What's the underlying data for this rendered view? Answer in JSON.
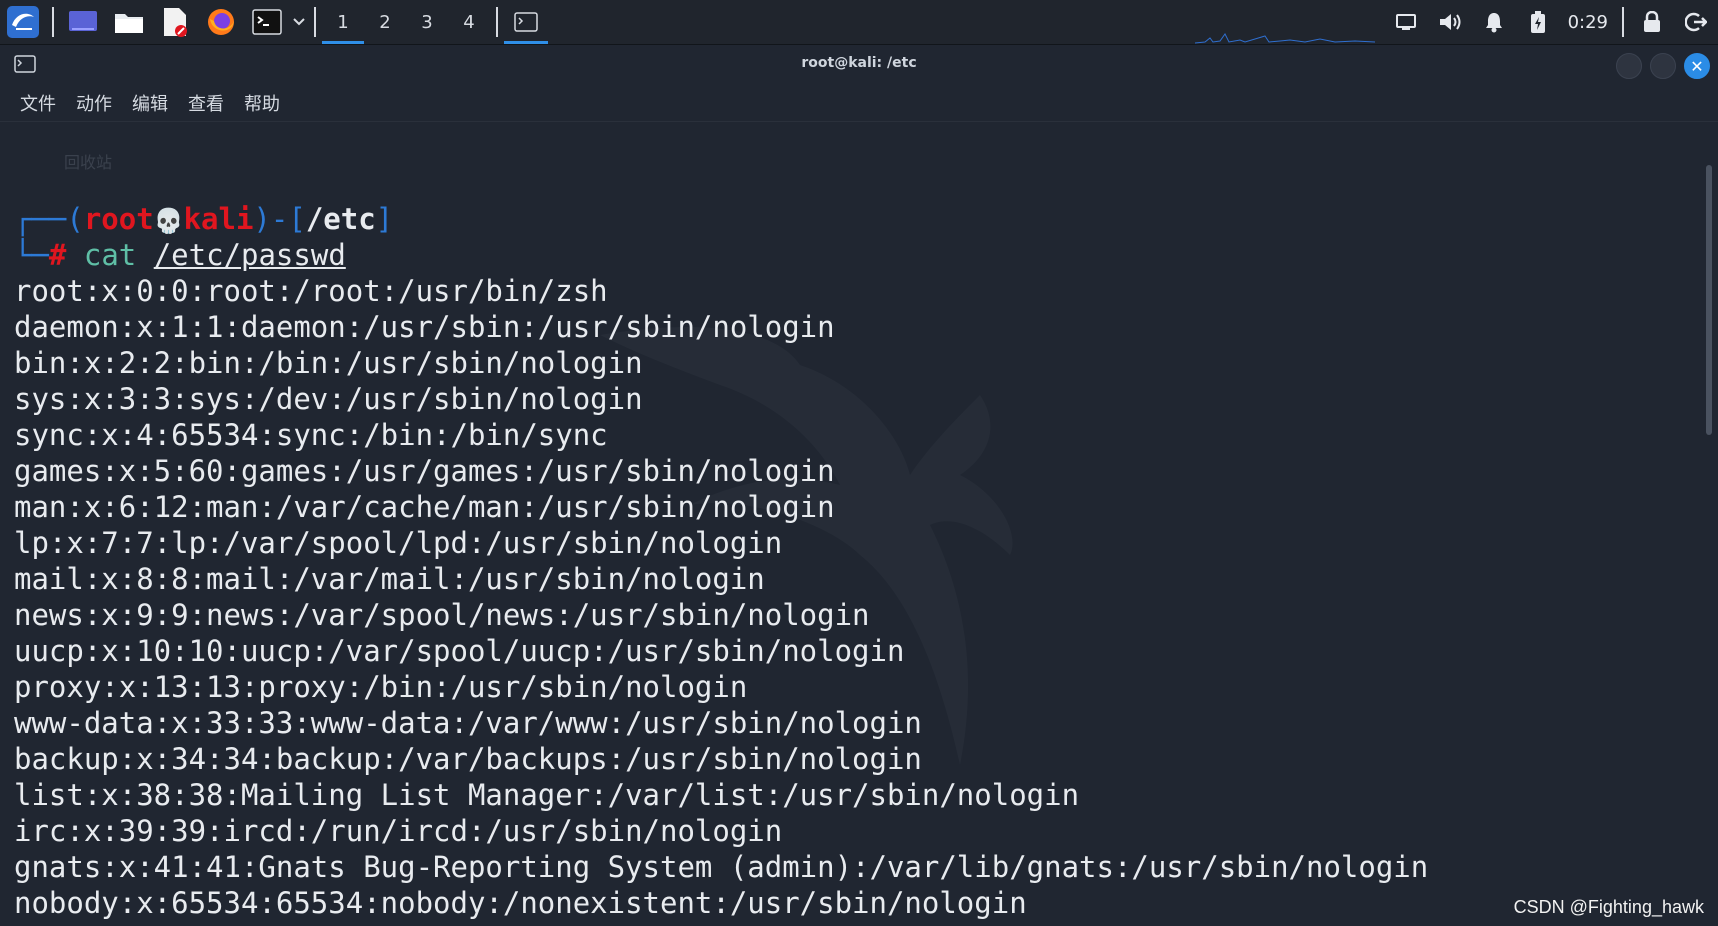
{
  "panel": {
    "workspaces": [
      "1",
      "2",
      "3",
      "4"
    ],
    "active_workspace": "1",
    "clock": "0:29",
    "icons": [
      "kali-menu-icon",
      "desktop-icon",
      "file-manager-icon",
      "text-editor-icon",
      "firefox-icon",
      "terminal-icon",
      "chevron-down-icon",
      "terminal-task-icon",
      "display-icon",
      "volume-icon",
      "bell-icon",
      "battery-icon",
      "lock-icon",
      "logout-icon"
    ]
  },
  "window": {
    "title": "root@kali: /etc",
    "menu": [
      "文件",
      "动作",
      "编辑",
      "查看",
      "帮助"
    ]
  },
  "prompt": {
    "box_open": "┌──(",
    "user": "root",
    "skull": "💀",
    "host": "kali",
    "mid": ")-[",
    "path": "/etc",
    "close": "]",
    "corner": "└─",
    "hash": "#",
    "command": "cat",
    "argument": "/etc/passwd"
  },
  "output": [
    "root:x:0:0:root:/root:/usr/bin/zsh",
    "daemon:x:1:1:daemon:/usr/sbin:/usr/sbin/nologin",
    "bin:x:2:2:bin:/bin:/usr/sbin/nologin",
    "sys:x:3:3:sys:/dev:/usr/sbin/nologin",
    "sync:x:4:65534:sync:/bin:/bin/sync",
    "games:x:5:60:games:/usr/games:/usr/sbin/nologin",
    "man:x:6:12:man:/var/cache/man:/usr/sbin/nologin",
    "lp:x:7:7:lp:/var/spool/lpd:/usr/sbin/nologin",
    "mail:x:8:8:mail:/var/mail:/usr/sbin/nologin",
    "news:x:9:9:news:/var/spool/news:/usr/sbin/nologin",
    "uucp:x:10:10:uucp:/var/spool/uucp:/usr/sbin/nologin",
    "proxy:x:13:13:proxy:/bin:/usr/sbin/nologin",
    "www-data:x:33:33:www-data:/var/www:/usr/sbin/nologin",
    "backup:x:34:34:backup:/var/backups:/usr/sbin/nologin",
    "list:x:38:38:Mailing List Manager:/var/list:/usr/sbin/nologin",
    "irc:x:39:39:ircd:/run/ircd:/usr/sbin/nologin",
    "gnats:x:41:41:Gnats Bug-Reporting System (admin):/var/lib/gnats:/usr/sbin/nologin",
    "nobody:x:65534:65534:nobody:/nonexistent:/usr/sbin/nologin"
  ],
  "desktop_ghost_label": "回收站",
  "watermark": "CSDN @Fighting_hawk",
  "colors": {
    "accent": "#2f8fe8",
    "prompt_red": "#e0161f",
    "prompt_blue": "#2d7ad6",
    "command_teal": "#5fbfa6",
    "terminal_bg": "#202631"
  }
}
